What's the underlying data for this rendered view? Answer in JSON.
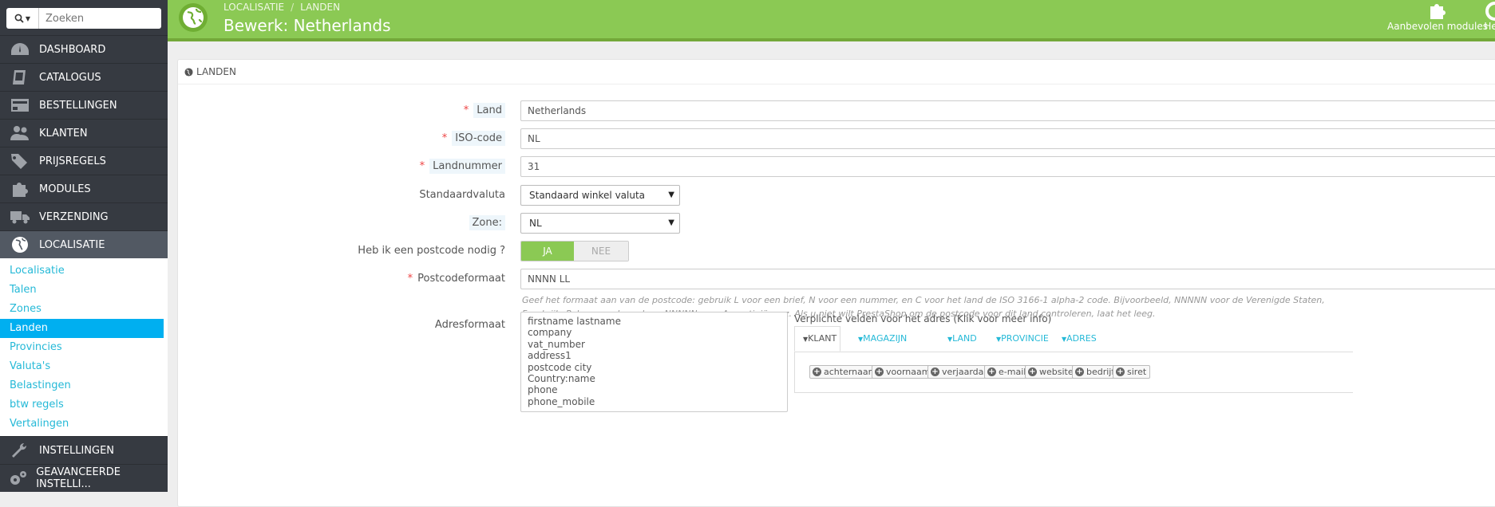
{
  "search": {
    "placeholder": "Zoeken"
  },
  "sidebar": {
    "items": [
      {
        "label": "DASHBOARD"
      },
      {
        "label": "CATALOGUS"
      },
      {
        "label": "BESTELLINGEN"
      },
      {
        "label": "KLANTEN"
      },
      {
        "label": "PRIJSREGELS"
      },
      {
        "label": "MODULES"
      },
      {
        "label": "VERZENDING"
      },
      {
        "label": "LOCALISATIE"
      }
    ],
    "subitems": [
      "Localisatie",
      "Talen",
      "Zones",
      "Landen",
      "Provincies",
      "Valuta's",
      "Belastingen",
      "btw regels",
      "Vertalingen"
    ],
    "bottom_items": [
      {
        "label": "INSTELLINGEN"
      },
      {
        "label": "GEAVANCEERDE INSTELLI..."
      }
    ]
  },
  "header": {
    "breadcrumb": [
      "LOCALISATIE",
      "LANDEN"
    ],
    "breadcrumb_sep": "/",
    "title": "Bewerk: Netherlands",
    "modules_label": "Aanbevolen modules",
    "help_label": "Help"
  },
  "panel": {
    "heading": "LANDEN",
    "fields": {
      "land": {
        "label": "Land",
        "value": "Netherlands"
      },
      "iso": {
        "label": "ISO-code",
        "value": "NL"
      },
      "landnummer": {
        "label": "Landnummer",
        "value": "31"
      },
      "valuta": {
        "label": "Standaardvaluta",
        "value": "Standaard winkel valuta"
      },
      "zone": {
        "label": "Zone:",
        "value": "NL"
      },
      "postcode_nodig": {
        "label": "Heb ik een postcode nodig ?",
        "yes": "JA",
        "no": "NEE"
      },
      "postcodeformaat": {
        "label": "Postcodeformaat",
        "value": "NNNN LL",
        "help": "Geef het formaat aan van de postcode: gebruik L voor een brief, N voor een nummer, en C voor het land de ISO 3166-1 alpha-2 code. Bijvoorbeeld, NNNNN voor de Verenigde Staten, Frankrijk, Polen en vele andere; NNNNN voor Argentinië, enz. Als u niet wilt PrestaShop om de postcode voor dit land controleren, laat het leeg."
      },
      "adresformaat": {
        "label": "Adresformaat",
        "lines": [
          "firstname lastname",
          "company",
          "vat_number",
          "address1",
          "postcode city",
          "Country:name",
          "phone",
          "phone_mobile"
        ]
      }
    },
    "required_fields": {
      "title": "Verplichte velden voor het adres (Klik voor meer info)",
      "tabs": [
        "KLANT",
        "MAGAZIJN",
        "LAND",
        "PROVINCIE",
        "ADRES"
      ],
      "chips": [
        "achternaam",
        "voornaam",
        "verjaardag",
        "e-mail",
        "website",
        "bedrijf",
        "siret"
      ]
    }
  }
}
